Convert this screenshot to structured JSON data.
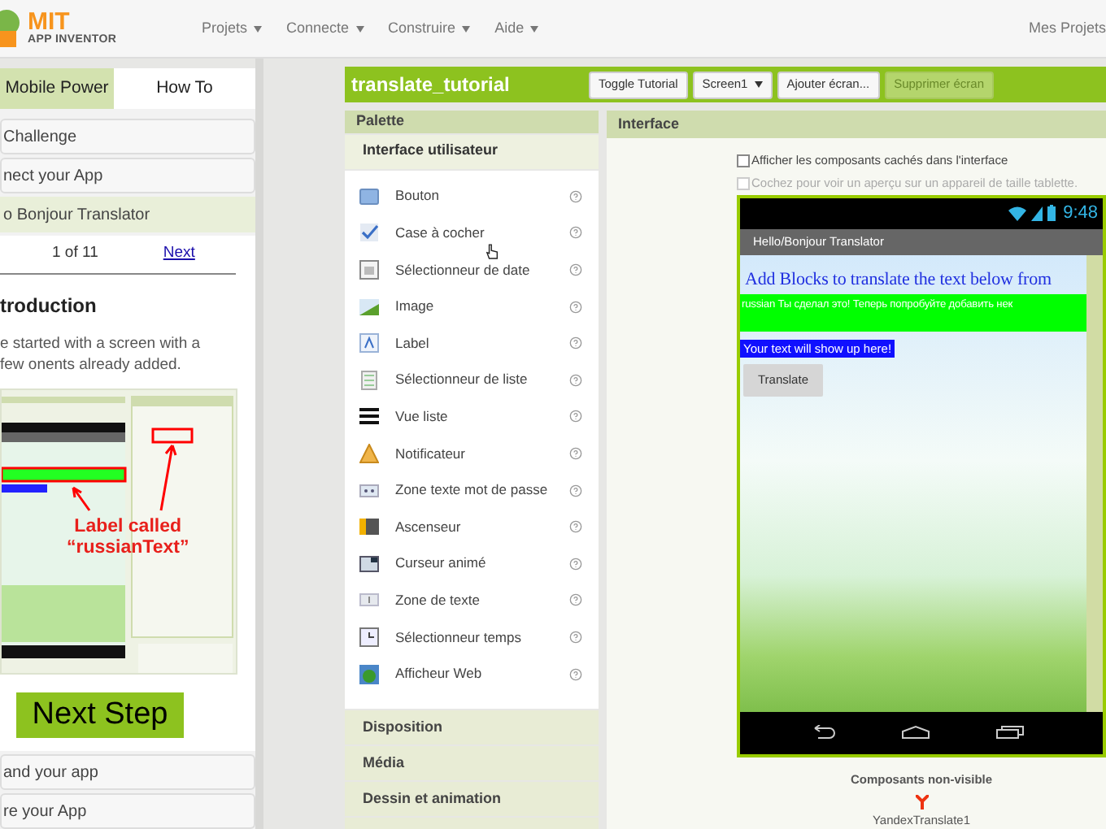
{
  "header": {
    "logo": {
      "title": "MIT",
      "subtitle": "APP INVENTOR"
    },
    "menu": [
      {
        "label": "Projets"
      },
      {
        "label": "Connecte"
      },
      {
        "label": "Construire"
      },
      {
        "label": "Aide"
      }
    ],
    "right_link": "Mes Projets"
  },
  "tutorial": {
    "tabs": [
      {
        "label": "Mobile Power",
        "selected": true
      },
      {
        "label": "How To",
        "selected": false
      }
    ],
    "sections": [
      {
        "title": "Challenge",
        "expanded": false
      },
      {
        "title": "nect your App",
        "expanded": false
      },
      {
        "title": "o Bonjour Translator",
        "expanded": true,
        "content": {
          "pager": {
            "position": "1 of 11",
            "next": "Next"
          },
          "heading": "troduction",
          "paragraph": "e started with a screen with a few onents already added.",
          "figure": {
            "annotation": [
              "Label called",
              "“russianText”"
            ]
          },
          "next_button": "Next Step"
        }
      },
      {
        "title": "and your app",
        "expanded": false
      },
      {
        "title": "re your App",
        "expanded": false
      }
    ]
  },
  "toolbar": {
    "project": "translate_tutorial",
    "buttons": [
      {
        "label": "Toggle Tutorial",
        "kind": "button",
        "disabled": false
      },
      {
        "label": "Screen1",
        "kind": "dropdown",
        "disabled": false
      },
      {
        "label": "Ajouter écran...",
        "kind": "button",
        "disabled": false
      },
      {
        "label": "Supprimer écran",
        "kind": "button",
        "disabled": true
      }
    ]
  },
  "palette": {
    "title": "Palette",
    "groups": [
      {
        "title": "Interface utilisateur",
        "expanded": true,
        "items": [
          {
            "label": "Bouton"
          },
          {
            "label": "Case à cocher"
          },
          {
            "label": "Sélectionneur de date"
          },
          {
            "label": "Image"
          },
          {
            "label": "Label"
          },
          {
            "label": "Sélectionneur de liste"
          },
          {
            "label": "Vue liste"
          },
          {
            "label": "Notificateur"
          },
          {
            "label": "Zone texte mot de passe"
          },
          {
            "label": "Ascenseur"
          },
          {
            "label": "Curseur animé"
          },
          {
            "label": "Zone de texte"
          },
          {
            "label": "Sélectionneur temps"
          },
          {
            "label": "Afficheur Web"
          }
        ]
      },
      {
        "title": "Disposition",
        "expanded": false
      },
      {
        "title": "Média",
        "expanded": false
      },
      {
        "title": "Dessin et animation",
        "expanded": false
      }
    ]
  },
  "viewer": {
    "title": "Interface",
    "options": [
      {
        "label": "Afficher les composants cachés dans l'interface",
        "checked": false,
        "disabled": false
      },
      {
        "label": "Cochez pour voir un aperçu sur un appareil de taille tablette.",
        "checked": false,
        "disabled": true
      }
    ],
    "phone": {
      "time": "9:48",
      "app_title": "Hello/Bonjour Translator",
      "components": [
        {
          "kind": "heading",
          "text": "Add Blocks to translate the text below from"
        },
        {
          "kind": "banner",
          "text": "russian Ты сделал это! Теперь попробуйте добавить нек"
        },
        {
          "kind": "label",
          "text": "Your text will show up here!"
        },
        {
          "kind": "button",
          "text": "Translate"
        }
      ]
    },
    "non_visible": {
      "title": "Composants non-visible",
      "items": [
        {
          "label": "YandexTranslate1"
        }
      ]
    }
  }
}
